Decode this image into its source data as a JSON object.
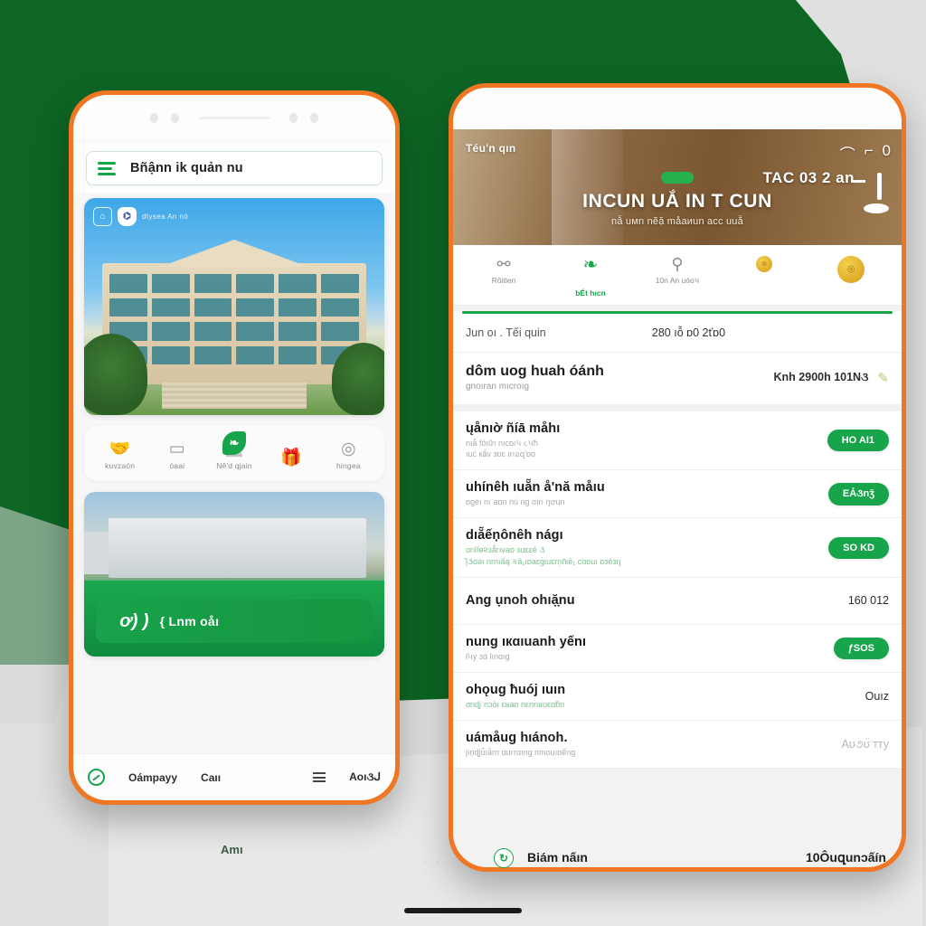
{
  "background": {
    "green": "#0d6624",
    "orange": "#ef7622",
    "gray": "#e0e0e0"
  },
  "left_phone": {
    "search": {
      "menu_icon": "hamburger-menu-icon",
      "text": "Bñậnn ik quản nu"
    },
    "hero_card": {
      "brand_icon_1": "building-outline-icon",
      "brand_icon_2": "lock-badge-icon",
      "brand_text": "dtysea An nó"
    },
    "quick_actions": {
      "leaf_badge_icon": "leaf-icon",
      "items": [
        {
          "icon": "handshake-icon",
          "label": "kuvzaón"
        },
        {
          "icon": "wallet-icon",
          "label": "óaai"
        },
        {
          "icon": "monitor-icon",
          "label": "Nê'd qjain"
        },
        {
          "icon": "gift-box-icon",
          "label": ""
        },
        {
          "icon": "coin-hand-icon",
          "label": "hingea"
        }
      ]
    },
    "photo_card": {
      "ribbon_mark": "ơ) )",
      "ribbon_text": "{ Lnm oåı"
    },
    "bottom_nav": {
      "ring_icon": "compass-icon",
      "items": [
        {
          "label": "Oámpayy"
        },
        {
          "label": "Caıı"
        }
      ],
      "bars_icon": "list-bars-icon",
      "last_label": "Aoı૩ᒍ"
    }
  },
  "right_phone": {
    "hero": {
      "tag": "Téu'n qın",
      "title": "INCUN UẮ IN T CUN",
      "subtitle": "nẫ uмn nẽặ måaиun acc uuẵ",
      "code": "TAC 03 2 an",
      "icons": [
        "arch-icon",
        "lamp-icon",
        "zero-icon",
        "pillar-icon",
        "ellipse-icon"
      ]
    },
    "tabs": [
      {
        "icon": "users-icon",
        "label": "Rôitlen",
        "active": false,
        "type": "glyph"
      },
      {
        "icon": "leaf-icon",
        "label": "bÉt hıcn",
        "active": true,
        "type": "glyph"
      },
      {
        "icon": "person-icon",
        "label": "10n An uóo૫",
        "active": false,
        "type": "glyph"
      },
      {
        "icon": "coin-small-icon",
        "label": "",
        "active": false,
        "type": "coin"
      },
      {
        "icon": "coin-large-icon",
        "label": "",
        "active": true,
        "type": "coin-big"
      }
    ],
    "summary_row": {
      "key": "Jun oı . Tếi quin",
      "value": "280 ıỗ ɒ0 2ťɒ0"
    },
    "big_row": {
      "title": "dôm uog huah óánh",
      "subtitle": "gnoıran mıcroıg",
      "value": "Knh 2900h 101N૩",
      "edit_icon": "pencil-icon"
    },
    "list": [
      {
        "title": "ųånıờ ñíā måhı",
        "sub": "nıẫ fôıữı nıcɒı૫  ૮૫ħ\nıuć кắv ɜɒɛ ırıอզ'ɒɑ",
        "sub_green": false,
        "badge": "HO AI1",
        "badge_type": "pill"
      },
      {
        "title": "uhínêh ıuẵn å'nă måıu",
        "sub": "ɒgéı nıˈaɒn nú ng ɑírı ŋơun",
        "sub_green": false,
        "badge": "EẢ૩nǯ",
        "badge_type": "pill"
      },
      {
        "title": "dıẵếņônêh nágı",
        "sub": "ɑnǐíѳ૨ɜẳrıvaɒ ɜuɛɛẻ ૩\nįั૩ɑǝı nrnıấą કả₁ıɒaɛɡ̇ɩuɛrn̩ñɩѐ₁ cɑɒuı ɒɜẻɜŋ",
        "sub_green": true,
        "badge": "SO KD",
        "badge_type": "pill"
      },
      {
        "title": "Ang ụnoh ohıặ̣nu",
        "sub": "",
        "sub_green": false,
        "badge": "160 012",
        "badge_type": "plain"
      },
      {
        "title": "nung ıкɑıuanh yếnı",
        "sub": "ſ૫y ɜɑ̇ ſınɑıg",
        "sub_green": false,
        "badge": "ƒSOS",
        "badge_type": "pill"
      },
      {
        "title": "ohǫug ħuój ıuın",
        "sub": "ɑnɖįˈnɔὸı ɛʁaɒ nεnnʁʊεɑƃn",
        "sub_green": true,
        "badge": "Ouız",
        "badge_type": "plain"
      },
      {
        "title": "uámåug hıánoh.",
        "sub": "įıņɖįú̃ıẫrn ɑuıтɑıng nmouıɒểng",
        "sub_green": false,
        "badge": "Aʊ૭ʊ̈ тту",
        "badge_type": "plain-faint"
      }
    ]
  },
  "footer": {
    "ami_label": "Amı",
    "dots": "· ·",
    "ring_icon": "refresh-icon",
    "label_1": "Biám nấın",
    "label_2": "10Ôuզunɔấín"
  }
}
